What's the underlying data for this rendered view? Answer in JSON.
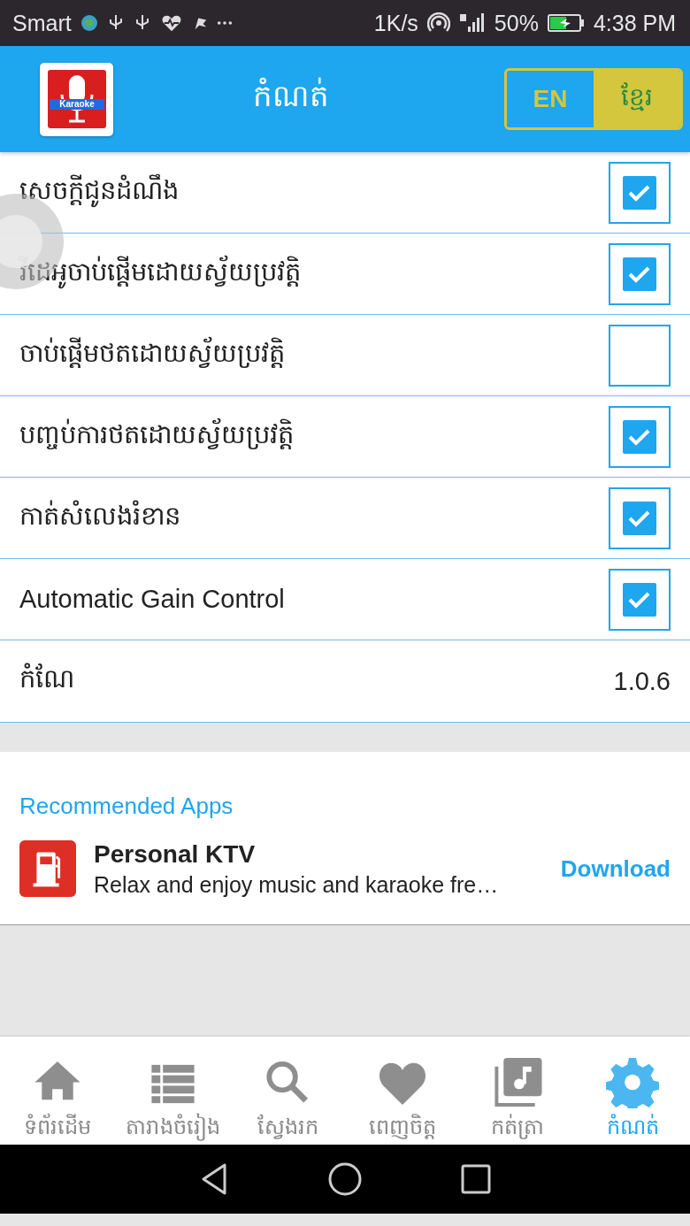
{
  "status_bar": {
    "carrier": "Smart",
    "speed": "1K/s",
    "battery": "50%",
    "time": "4:38 PM"
  },
  "header": {
    "logo_text": "Karaoke",
    "title": "កំណត់",
    "languages": [
      {
        "label": "EN",
        "selected": false
      },
      {
        "label": "ខ្មែរ",
        "selected": true
      }
    ]
  },
  "settings": [
    {
      "label": "សេចក្ដីជូនដំណឹង",
      "checked": true
    },
    {
      "label": "វីដេអូចាប់ផ្ដើមដោយស្វ័យប្រវត្តិ",
      "checked": true
    },
    {
      "label": "ចាប់ផ្ដើមថតដោយស្វ័យប្រវត្តិ",
      "checked": false
    },
    {
      "label": "បញ្ចប់ការថតដោយស្វ័យប្រវត្តិ",
      "checked": true
    },
    {
      "label": "កាត់សំលេងរំខាន",
      "checked": true
    },
    {
      "label": "Automatic Gain Control",
      "checked": true
    }
  ],
  "version": {
    "label": "កំណែ",
    "value": "1.0.6"
  },
  "recommended": {
    "heading": "Recommended Apps",
    "apps": [
      {
        "name": "Personal KTV",
        "description": "Relax and enjoy music and karaoke fre…",
        "action": "Download"
      }
    ]
  },
  "bottom_nav": [
    {
      "label": "ទំព័រដើម",
      "kind": "home",
      "selected": false
    },
    {
      "label": "តារាងចំរៀង",
      "kind": "list",
      "selected": false
    },
    {
      "label": "ស្វែងរក",
      "kind": "search",
      "selected": false
    },
    {
      "label": "ពេញចិត្ត",
      "kind": "heart",
      "selected": false
    },
    {
      "label": "កត់ត្រា",
      "kind": "music",
      "selected": false
    },
    {
      "label": "កំណត់",
      "kind": "settings",
      "selected": true
    }
  ]
}
